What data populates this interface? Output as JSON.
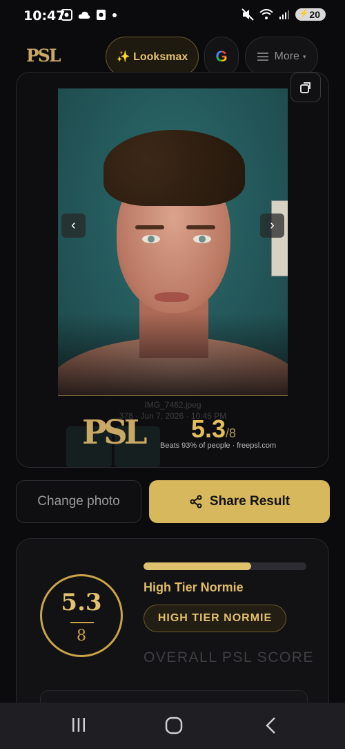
{
  "status_bar": {
    "time": "10:47",
    "battery": "20"
  },
  "nav": {
    "logo": "PSL",
    "looksmax_label": "✨ Looksmax",
    "google_label": "G",
    "more_label": "More",
    "more_caret": "▾"
  },
  "result_card": {
    "photo_meta_line1": "IMG_7462.jpeg",
    "photo_meta_line2": "378 · Jun 7, 2026 · 10:45 PM",
    "brand": "PSL",
    "score": "5.3",
    "score_denominator": "/8",
    "beats_text": "Beats 93% of people  ·  freepsl.com"
  },
  "buttons": {
    "change_photo": "Change photo",
    "share_result": "Share Result"
  },
  "score_card": {
    "score": "5.3",
    "denominator": "8",
    "progress_fraction": 0.66,
    "tier_label": "High Tier Normie",
    "tier_badge": "HIGH TIER NORMIE",
    "overall_label": "OVERALL PSL SCORE"
  },
  "colors": {
    "accent_gold": "#d8b85c",
    "background": "#0b0b0d"
  }
}
